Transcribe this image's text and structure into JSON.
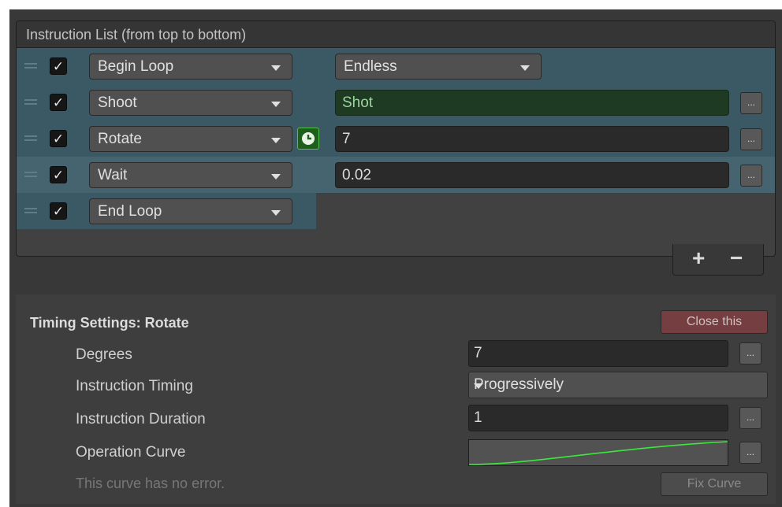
{
  "list": {
    "header": "Instruction List (from top to bottom)",
    "rows": [
      {
        "enabled": true,
        "instruction": "Begin Loop",
        "param": "Endless",
        "param_type": "dropdown"
      },
      {
        "enabled": true,
        "instruction": "Shoot",
        "param": "Shot",
        "param_type": "object"
      },
      {
        "enabled": true,
        "instruction": "Rotate",
        "param": "7",
        "param_type": "number",
        "timed": true
      },
      {
        "enabled": true,
        "instruction": "Wait",
        "param": "0.02",
        "param_type": "number"
      },
      {
        "enabled": true,
        "instruction": "End Loop",
        "param": "",
        "param_type": "none"
      }
    ],
    "add_label": "+",
    "remove_label": "−"
  },
  "timing": {
    "title": "Timing Settings: Rotate",
    "close_label": "Close this",
    "degrees_label": "Degrees",
    "degrees_value": "7",
    "timing_label": "Instruction Timing",
    "timing_value": "Progressively",
    "duration_label": "Instruction Duration",
    "duration_value": "1",
    "curve_label": "Operation Curve",
    "hint": "This curve has no error.",
    "fix_label": "Fix Curve",
    "dots": "..."
  },
  "colors": {
    "accent_row": "#3b5965",
    "curve": "#3be83b",
    "clock_bg": "#1f5f1d"
  },
  "icons": [
    "drag-handle-icon",
    "checkmark-icon",
    "dropdown-arrow-icon",
    "clock-icon"
  ]
}
